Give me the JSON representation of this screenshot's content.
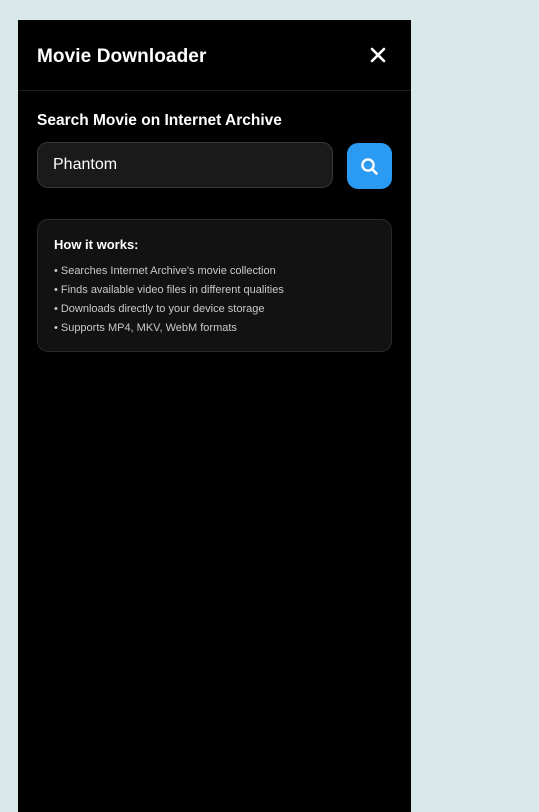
{
  "header": {
    "title": "Movie Downloader",
    "close_icon": "close-icon"
  },
  "search": {
    "label": "Search Movie on Internet Archive",
    "value": "Phantom",
    "button_icon": "search-icon"
  },
  "info": {
    "title": "How it works:",
    "items": [
      "Searches Internet Archive's movie collection",
      "Finds available video files in different qualities",
      "Downloads directly to your device storage",
      "Supports MP4, MKV, WebM formats"
    ]
  },
  "colors": {
    "page_background": "#d9e9ea",
    "panel_background": "#000000",
    "accent": "#2b9af3"
  }
}
